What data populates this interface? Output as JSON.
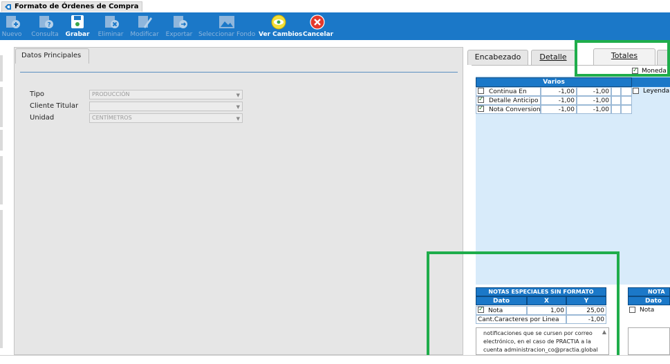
{
  "window": {
    "title": "Formato de Órdenes de Compra"
  },
  "toolbar": {
    "buttons": [
      {
        "label": "Nuevo",
        "icon": "new-document-icon",
        "enabled": false
      },
      {
        "label": "Consulta",
        "icon": "query-document-icon",
        "enabled": false
      },
      {
        "label": "Grabar",
        "icon": "save-icon",
        "enabled": true
      },
      {
        "label": "Eliminar",
        "icon": "delete-document-icon",
        "enabled": false
      },
      {
        "label": "Modificar",
        "icon": "edit-document-icon",
        "enabled": false
      },
      {
        "label": "Exportar",
        "icon": "export-document-icon",
        "enabled": false
      },
      {
        "label": "Seleccionar Fondo",
        "icon": "image-icon",
        "enabled": false
      },
      {
        "label": "Ver Cambios",
        "icon": "view-changes-icon",
        "enabled": true
      },
      {
        "label": "Cancelar",
        "icon": "cancel-icon",
        "enabled": true
      }
    ]
  },
  "left_panel": {
    "tab_label": "Datos Principales",
    "fields": [
      {
        "label": "Tipo",
        "value": "PRODUCCIÓN"
      },
      {
        "label": "Cliente Titular",
        "value": ""
      },
      {
        "label": "Unidad",
        "value": "CENTÍMETROS"
      }
    ]
  },
  "right_panel": {
    "tabs": [
      {
        "label": "Encabezado",
        "active": false
      },
      {
        "label": "Detalle",
        "active": false
      },
      {
        "label": "Totales",
        "active": true
      }
    ],
    "moneda_label": "Moneda",
    "moneda_checked": true,
    "varios": {
      "header": "Varios",
      "rows": [
        {
          "label": "Continua En",
          "checked": false,
          "x": "-1,00",
          "y": "-1,00"
        },
        {
          "label": "Detalle Anticipo",
          "checked": true,
          "x": "-1,00",
          "y": "-1,00"
        },
        {
          "label": "Nota Conversion",
          "checked": true,
          "x": "-1,00",
          "y": "-1,00"
        }
      ]
    },
    "leyenda": {
      "label": "Leyenda",
      "checked": false
    },
    "notas_especiales": {
      "header": "NOTAS ESPECIALES SIN FORMATO",
      "columns": [
        "Dato",
        "X",
        "Y"
      ],
      "row": {
        "label": "Nota",
        "checked": true,
        "x": "1,00",
        "y": "25,00"
      },
      "chars_label": "Cant.Caracteres por Linea",
      "chars_value": "-1,00",
      "memo_text": "notificaciones que se cursen por correo electrónico, en el caso de PRACTIA a la cuenta administracion_co@practia.global"
    },
    "nota_right": {
      "header": "NOTA E",
      "columns": [
        "Dato"
      ],
      "row": {
        "label": "Nota",
        "checked": false
      }
    }
  },
  "colors": {
    "toolbar_blue": "#1b78c8",
    "grid_header_blue": "#1b78c8",
    "highlight_green": "#1fad4b",
    "panel_grey": "#e6e6e6",
    "light_blue_area": "#d8ebfa"
  }
}
